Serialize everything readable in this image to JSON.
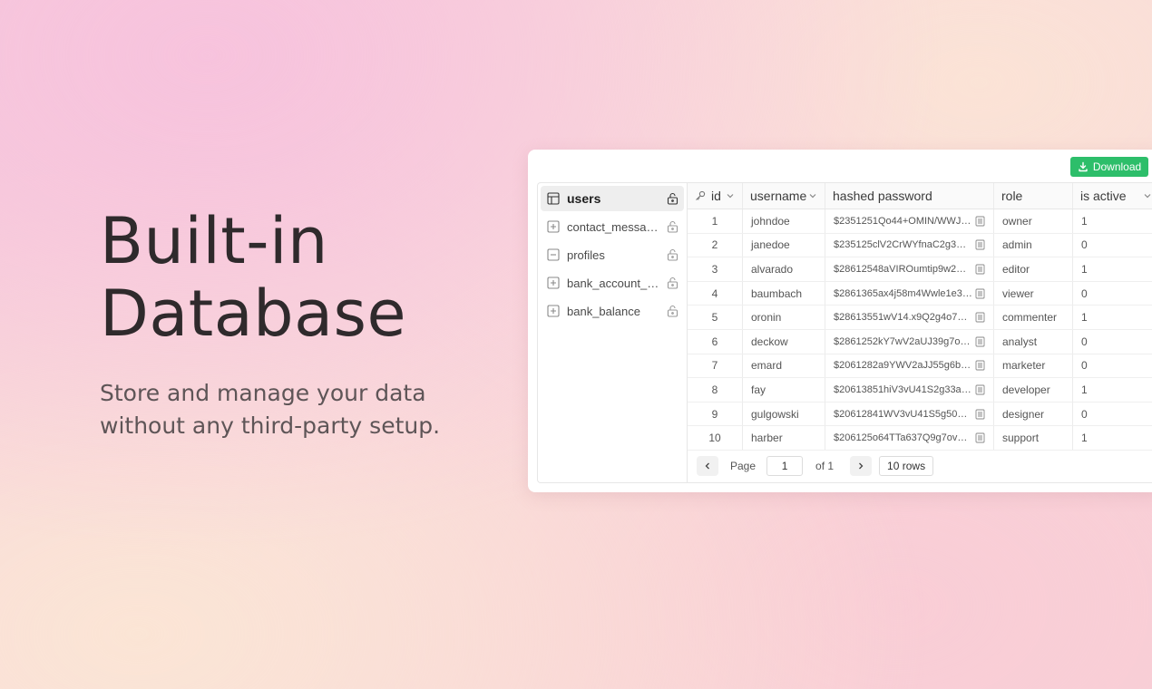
{
  "hero": {
    "title": "Built-in\nDatabase",
    "subtitle": "Store and manage your data\nwithout any third-party setup."
  },
  "toolbar": {
    "download_label": "Download",
    "download_color": "#2dbe6a"
  },
  "sidebar": {
    "items": [
      {
        "label": "users",
        "icon": "table-icon",
        "active": true
      },
      {
        "label": "contact_messages",
        "icon": "table-plus-icon",
        "active": false
      },
      {
        "label": "profiles",
        "icon": "table-minus-icon",
        "active": false
      },
      {
        "label": "bank_account_per...",
        "icon": "table-plus-icon",
        "active": false
      },
      {
        "label": "bank_balance",
        "icon": "table-plus-icon",
        "active": false
      }
    ]
  },
  "table": {
    "columns": [
      "id",
      "username",
      "hashed password",
      "role",
      "is active"
    ],
    "rows": [
      [
        "1",
        "johndoe",
        "$2351251Qo44+OMIN/WWJSREHg...",
        "owner",
        "1"
      ],
      [
        "2",
        "janedoe",
        "$235125clV2CrWYfnaC2g3VU...",
        "admin",
        "0"
      ],
      [
        "3",
        "alvarado",
        "$28612548aVIROumtip9w2HQj...",
        "editor",
        "1"
      ],
      [
        "4",
        "baumbach",
        "$2861365ax4j58m4Wwle1e37...",
        "viewer",
        "0"
      ],
      [
        "5",
        "oronin",
        "$28613551wV14.x9Q2g4o7w6o2...",
        "commenter",
        "1"
      ],
      [
        "6",
        "deckow",
        "$2861252kY7wV2aUJ39g7o2o4...",
        "analyst",
        "0"
      ],
      [
        "7",
        "emard",
        "$2061282a9YWV2aJJ55g6b2n1...",
        "marketer",
        "0"
      ],
      [
        "8",
        "fay",
        "$20613851hiV3vU41S2g33a4n1...",
        "developer",
        "1"
      ],
      [
        "9",
        "gulgowski",
        "$20612841WV3vU41S5g502n1...",
        "designer",
        "0"
      ],
      [
        "10",
        "harber",
        "$206125o64TTa637Q9g7ovSl...",
        "support",
        "1"
      ]
    ]
  },
  "pagination": {
    "page_label": "Page",
    "page_value": "1",
    "of_label": "of 1",
    "rows_label": "10 rows"
  }
}
